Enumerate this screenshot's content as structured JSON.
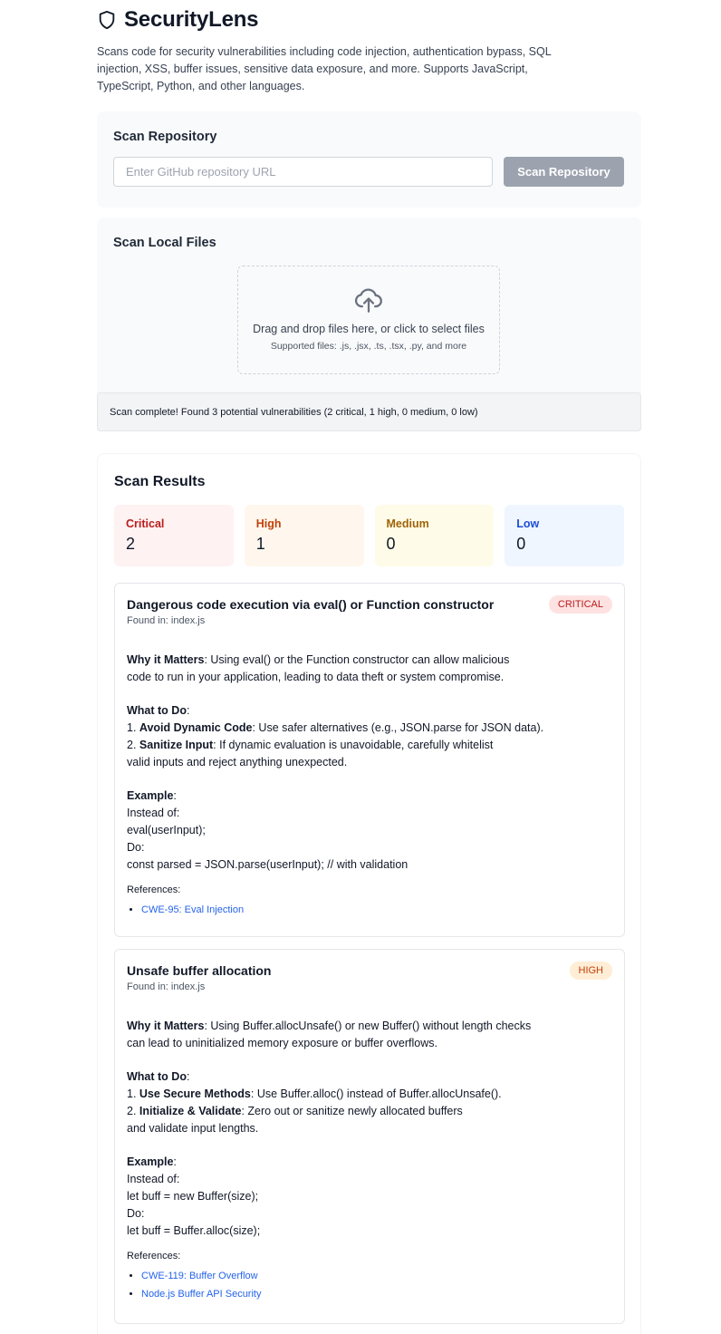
{
  "app": {
    "title": "SecurityLens",
    "logo_icon": "shield-icon",
    "description": "Scans code for security vulnerabilities including code injection, authentication bypass, SQL injection, XSS, buffer issues, sensitive data exposure, and more. Supports JavaScript, TypeScript, Python, and other languages."
  },
  "scan_repo": {
    "heading": "Scan Repository",
    "placeholder": "Enter GitHub repository URL",
    "value": "",
    "button_label": "Scan Repository"
  },
  "scan_local": {
    "heading": "Scan Local Files",
    "upload_icon": "cloud-upload-icon",
    "drop_text": "Drag and drop files here, or click to select files",
    "supported_text": "Supported files: .js, .jsx, .ts, .tsx, .py, and more"
  },
  "status_message": "Scan complete! Found 3 potential vulnerabilities (2 critical, 1 high, 0 medium, 0 low)",
  "results": {
    "heading": "Scan Results",
    "summary": [
      {
        "label": "Critical",
        "count": "2",
        "color": "#b91c1c"
      },
      {
        "label": "High",
        "count": "1",
        "color": "#c2410c"
      },
      {
        "label": "Medium",
        "count": "0",
        "color": "#a16207"
      },
      {
        "label": "Low",
        "count": "0",
        "color": "#1d4ed8"
      }
    ],
    "vulnerabilities": [
      {
        "title": "Dangerous code execution via eval() or Function constructor",
        "badge": "CRITICAL",
        "file": "Found in: index.js",
        "why_label": "Why it Matters",
        "why_line1": ": Using eval() or the Function constructor can allow malicious",
        "why_line2": "code to run in your application, leading to data theft or system compromise.",
        "todo_label": "What to Do",
        "todo_colon": ":",
        "step1_num": "1. ",
        "step1_label": "Avoid Dynamic Code",
        "step1_text": ": Use safer alternatives (e.g., JSON.parse for JSON data).",
        "step2_num": "2. ",
        "step2_label": "Sanitize Input",
        "step2_text": ": If dynamic evaluation is unavoidable, carefully whitelist",
        "step2_line2": "valid inputs and reject anything unexpected.",
        "example_label": "Example",
        "example_colon": ":",
        "example_lines": [
          "Instead of:",
          "eval(userInput);",
          "Do:",
          "const parsed = JSON.parse(userInput); // with validation"
        ],
        "refs_label": "References:",
        "refs": [
          "CWE-95: Eval Injection"
        ]
      },
      {
        "title": "Unsafe buffer allocation",
        "badge": "HIGH",
        "file": "Found in: index.js",
        "why_label": "Why it Matters",
        "why_line1": ": Using Buffer.allocUnsafe() or new Buffer() without length checks",
        "why_line2": "can lead to uninitialized memory exposure or buffer overflows.",
        "todo_label": "What to Do",
        "todo_colon": ":",
        "step1_num": "1. ",
        "step1_label": "Use Secure Methods",
        "step1_text": ": Use Buffer.alloc() instead of Buffer.allocUnsafe().",
        "step2_num": "2. ",
        "step2_label": "Initialize & Validate",
        "step2_text": ": Zero out or sanitize newly allocated buffers",
        "step2_line2": "and validate input lengths.",
        "example_label": "Example",
        "example_colon": ":",
        "example_lines": [
          "Instead of:",
          "let buff = new Buffer(size);",
          "Do:",
          "let buff = Buffer.alloc(size);"
        ],
        "refs_label": "References:",
        "refs": [
          "CWE-119: Buffer Overflow",
          "Node.js Buffer API Security"
        ]
      }
    ]
  }
}
